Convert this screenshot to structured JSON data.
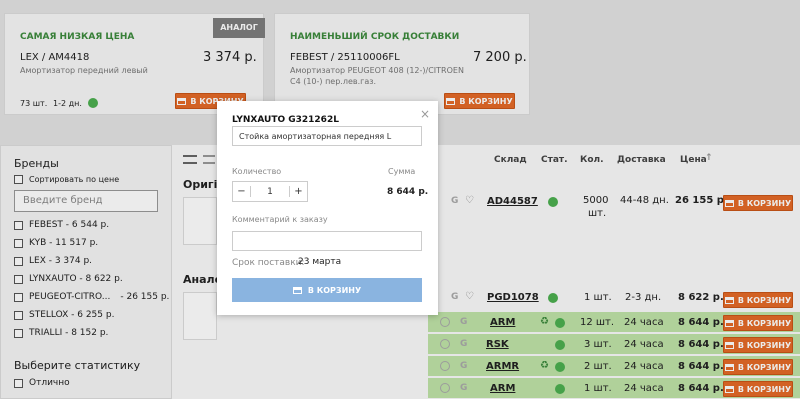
{
  "cards": [
    {
      "title": "САМАЯ НИЗКАЯ ЦЕНА",
      "code": "LEX / AM4418",
      "price": "3 374 р.",
      "desc": "Амортизатор передний левый",
      "stock": "73 шт.",
      "days": "1-2 дн.",
      "badge": "АНАЛОГ",
      "button": "В КОРЗИНУ"
    },
    {
      "title": "НАИМЕНЬШИЙ СРОК ДОСТАВКИ",
      "code": "FEBEST / 25110006FL",
      "price": "7 200 р.",
      "desc": "Амортизатор PEUGEOT 408 (12-)/CITROEN C4 (10-) пер.лев.газ.",
      "button": "В КОРЗИНУ"
    }
  ],
  "sidebar": {
    "brands_heading": "Бренды",
    "sort_label": "Сортировать по цене",
    "brand_placeholder": "Введите бренд",
    "brands": [
      "FEBEST - 6 544 р.",
      "KYB - 11 517 р.",
      "LEX - 3 374 р.",
      "LYNXAUTO - 8 622 р.",
      "PEUGEOT-CITRO...",
      "STELLOX - 6 255 р.",
      "TRIALLI - 8 152 р."
    ],
    "peugeot_price": "- 26 155 р.",
    "stats_heading": "Выберите статистику",
    "stats": [
      "Отлично"
    ]
  },
  "main": {
    "original_heading": "Оригі",
    "analog_heading": "Анало",
    "columns": [
      "Склад",
      "Стат.",
      "Кол.",
      "Доставка",
      "Цена"
    ],
    "sort_arrow": "↑",
    "rows": [
      {
        "code": "AD44587",
        "qty": "5000",
        "unit": "шт.",
        "delivery": "44-48 дн.",
        "price": "26 155 р.",
        "button": "В КОРЗИНУ"
      },
      {
        "code": "PGD1078",
        "qty": "1 шт.",
        "delivery": "2-3 дн.",
        "price": "8 622 р.",
        "button": "В КОРЗИНУ"
      },
      {
        "code": "ARM",
        "qty": "12 шт.",
        "delivery": "24 часа",
        "price": "8 644 р.",
        "button": "В КОРЗИНУ"
      },
      {
        "code": "RSK",
        "qty": "3 шт.",
        "delivery": "24 часа",
        "price": "8 644 р.",
        "button": "В КОРЗИНУ"
      },
      {
        "code": "ARMR",
        "qty": "2 шт.",
        "delivery": "24 часа",
        "price": "8 644 р.",
        "button": "В КОРЗИНУ"
      },
      {
        "code": "ARM",
        "qty": "1 шт.",
        "delivery": "24 часа",
        "price": "8 644 р.",
        "button": "В КОРЗИНУ"
      }
    ]
  },
  "modal": {
    "title": "LYNXAUTO G321262L",
    "product": "Стойка амортизаторная передняя L",
    "qty_label": "Количество",
    "sum_label": "Сумма",
    "qty_value": "1",
    "minus": "−",
    "plus": "+",
    "sum_value": "8 644 р.",
    "comment_label": "Комментарий к заказу",
    "comment_value": "",
    "delivery_label": "Срок поставки:",
    "delivery_value": "23 марта",
    "submit": "В КОРЗИНУ",
    "close": "×"
  },
  "colors": {
    "accent_orange": "#e46a28",
    "green": "#4caf50",
    "modal_button": "#8ab4e0",
    "title_green": "#3c8a3c",
    "row_green": "#bfe3a8"
  }
}
